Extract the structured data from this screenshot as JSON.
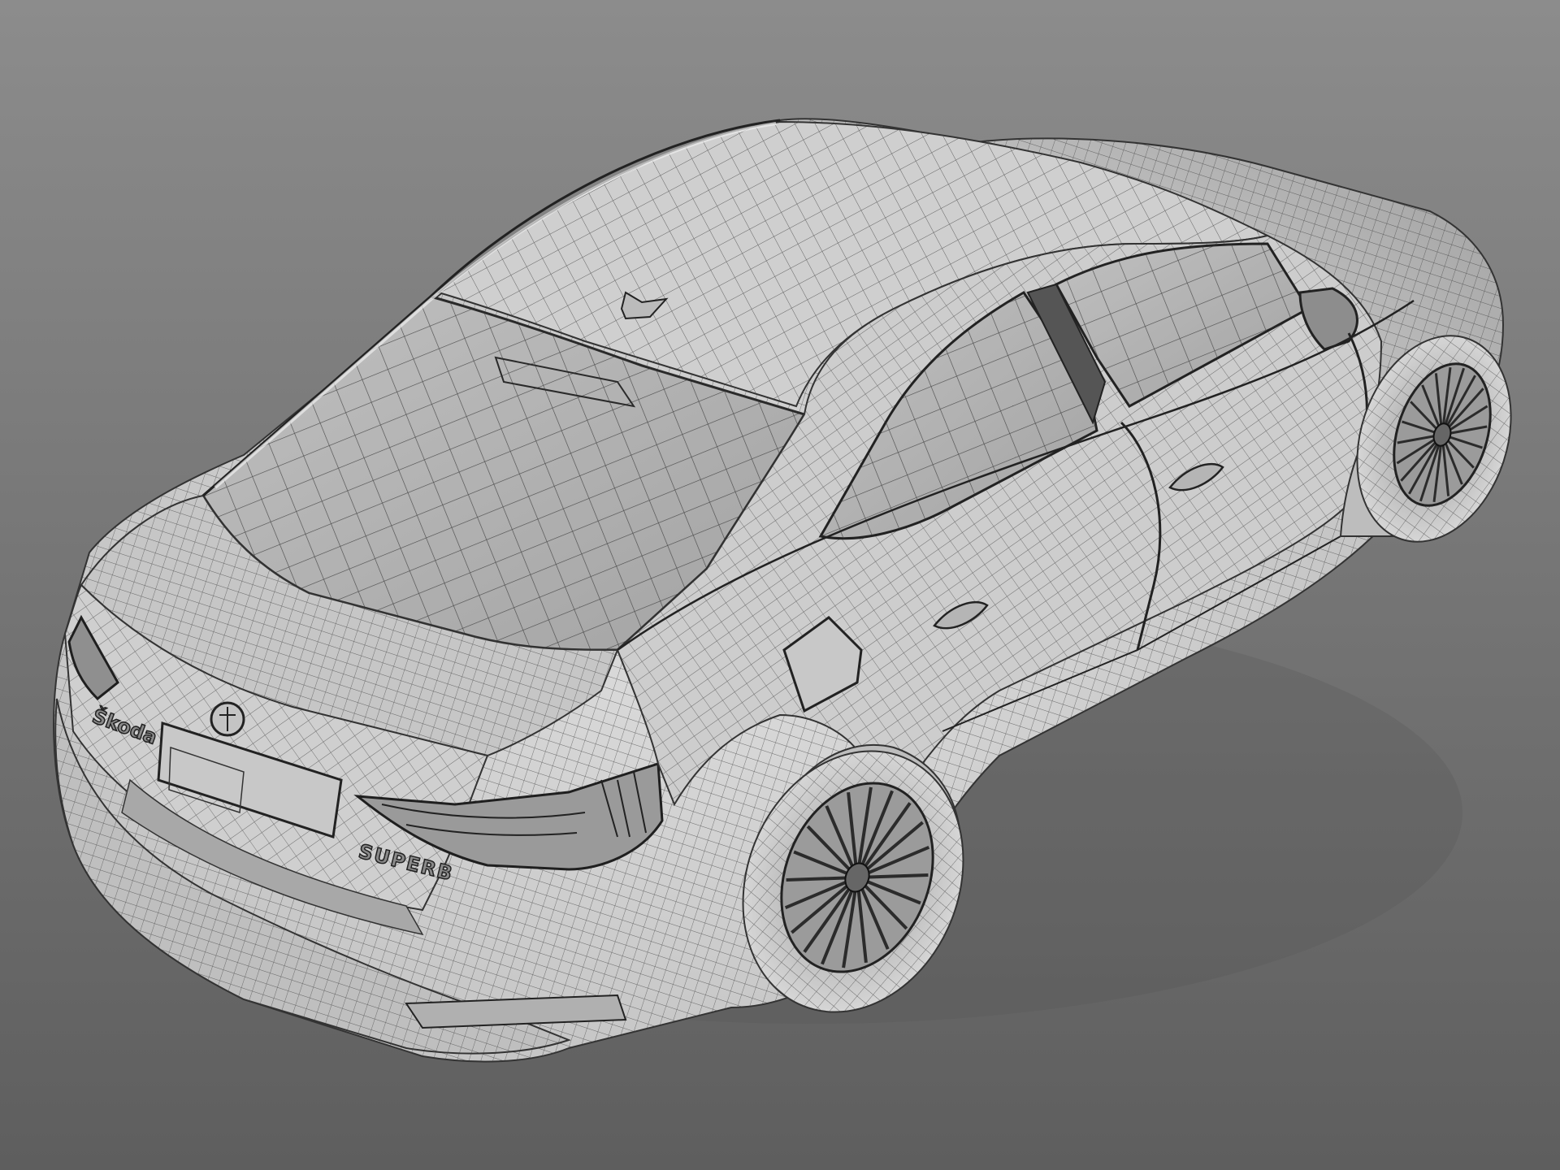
{
  "scene": {
    "subject": "car-wireframe-render",
    "background_top": "#8c8c8c",
    "background_bottom": "#5e5e5e",
    "body_fill": "#d4d4d4",
    "body_shade": "#a9a9a9",
    "glass_fill": "#b3b3b3",
    "wire_color": "#3a3a3a",
    "tire_fill": "#c9c9c9",
    "rim_fill": "#9b9b9b"
  },
  "badges": {
    "brand_lettering": "Škoda",
    "model_lettering": "SUPERB"
  }
}
